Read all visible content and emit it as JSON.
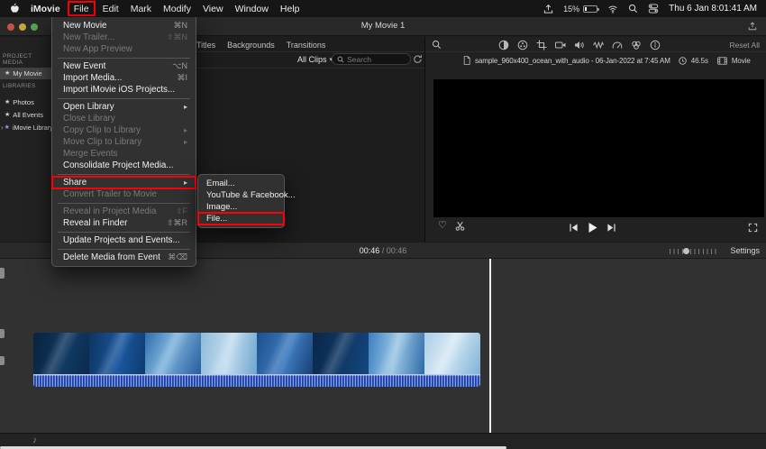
{
  "colors": {
    "annotation_red": "#fb0007",
    "waveform_blue": "#2d55c6",
    "selection_gray": "#434343"
  },
  "icons": {
    "submenu_arrow": "▸",
    "chevron_down": "▾",
    "heart": "♡",
    "note": "♪",
    "star": "★",
    "disclosure": "›"
  },
  "menubar": {
    "items": [
      "iMovie",
      "File",
      "Edit",
      "Mark",
      "Modify",
      "View",
      "Window",
      "Help"
    ],
    "battery": "15%",
    "clock": "Thu 6 Jan 8:01:41 AM"
  },
  "titlebar": {
    "title": "My Movie 1"
  },
  "sidebar": {
    "section1": "PROJECT MEDIA",
    "project": "My Movie",
    "section2": "LIBRARIES",
    "items": [
      "Photos",
      "All Events",
      "iMovie Library"
    ]
  },
  "browser": {
    "tabs": [
      "Titles",
      "Backgrounds",
      "Transitions"
    ],
    "clip_filter": "All Clips",
    "search_placeholder": "Search"
  },
  "file_menu": {
    "items": [
      {
        "label": "New Movie",
        "shortcut": "⌘N"
      },
      {
        "label": "New Trailer...",
        "shortcut": "⇧⌘N"
      },
      {
        "label": "New App Preview",
        "shortcut": ""
      },
      {
        "label": "New Event",
        "shortcut": "⌥N"
      },
      {
        "label": "Import Media...",
        "shortcut": "⌘I"
      },
      {
        "label": "Import iMovie iOS Projects...",
        "shortcut": ""
      },
      {
        "label": "Open Library",
        "shortcut": ""
      },
      {
        "label": "Close Library",
        "shortcut": ""
      },
      {
        "label": "Copy Clip to Library",
        "shortcut": ""
      },
      {
        "label": "Move Clip to Library",
        "shortcut": ""
      },
      {
        "label": "Merge Events",
        "shortcut": ""
      },
      {
        "label": "Consolidate Project Media...",
        "shortcut": ""
      },
      {
        "label": "Share",
        "shortcut": ""
      },
      {
        "label": "Convert Trailer to Movie",
        "shortcut": ""
      },
      {
        "label": "Reveal in Project Media",
        "shortcut": "⇧F"
      },
      {
        "label": "Reveal in Finder",
        "shortcut": "⇧⌘R"
      },
      {
        "label": "Update Projects and Events...",
        "shortcut": ""
      },
      {
        "label": "Delete Media from Event",
        "shortcut": "⌘⌫"
      }
    ]
  },
  "share_menu": {
    "items": [
      {
        "label": "Email..."
      },
      {
        "label": "YouTube & Facebook..."
      },
      {
        "label": "Image..."
      },
      {
        "label": "File..."
      }
    ]
  },
  "viewer": {
    "reset_all": "Reset All",
    "clip_name": "sample_960x400_ocean_with_audio - 06-Jan-2022 at 7:45 AM",
    "duration": "46.5s",
    "media_kind": "Movie"
  },
  "transport": {
    "elapsed": "00:46",
    "separator": "/",
    "total": "00:46",
    "settings_label": "Settings"
  }
}
